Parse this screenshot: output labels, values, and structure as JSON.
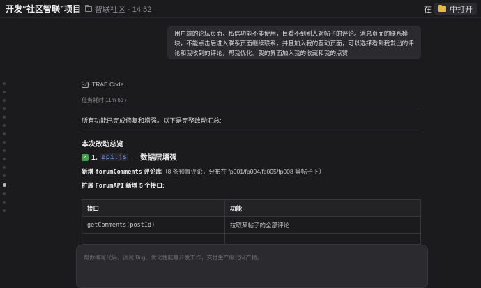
{
  "header": {
    "title": "开发“社区智联”项目",
    "breadcrumb": "智联社区 · 14:52",
    "open_in_prefix": "在",
    "open_in_label": "中打开"
  },
  "user_message": "用户端的论坛页面，私信功能不能使用，目看不到别人对帖子的评论。消息页面的联系模块，不能点击后进入联系页面继续联系，并且加入我的互动页面，可以选择看到我发出的评论和我收到的评论，帮我优化。我的界面加入我的收藏和我的点赞",
  "agent": {
    "name": "TRAE Code",
    "icon_text": "</>",
    "duration": "任务耗时 11m 6s",
    "duration_chevron": "›",
    "summary": "所有功能已完成修复和增强。以下是完整改动汇总:",
    "section_title": "本次改动总览",
    "item1": {
      "check_icon": "✓",
      "number": "1.",
      "file": "api.js",
      "title": "— 数据层增强"
    },
    "line1": {
      "prefix": "新增",
      "code": "forumComments",
      "label": "评论库",
      "detail": "（8 条预置评论，分布在 fp001/fp004/fp005/fp008 等帖子下）"
    },
    "line2": {
      "prefix": "扩展",
      "code": "ForumAPI",
      "label": "新增 5 个接口:"
    }
  },
  "api_table": {
    "headers": [
      "接口",
      "功能"
    ],
    "rows": [
      [
        "getComments(postId)",
        "拉取某帖子的全部评论"
      ]
    ]
  },
  "composer": {
    "placeholder": "帮你编写代码、调试 Bug、优化性能等开发工作，交付生产级代码产物。"
  }
}
